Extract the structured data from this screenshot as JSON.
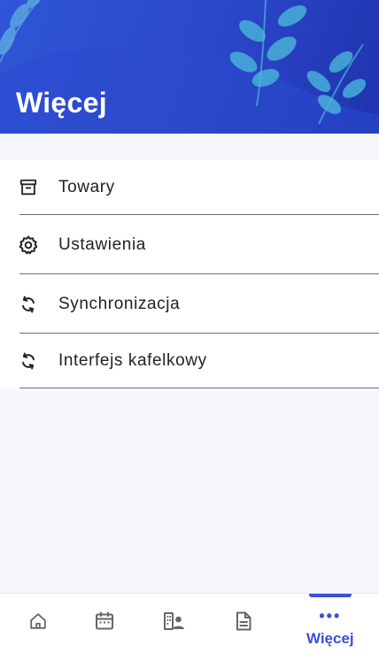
{
  "header": {
    "title": "Więcej"
  },
  "menu": {
    "items": [
      {
        "label": "Towary",
        "icon": "archive-box-icon"
      },
      {
        "label": "Ustawienia",
        "icon": "gear-icon"
      },
      {
        "label": "Synchronizacja",
        "icon": "sync-icon"
      },
      {
        "label": "Interfejs kafelkowy",
        "icon": "sync-icon"
      }
    ]
  },
  "bottom_nav": {
    "items": [
      {
        "icon": "home-icon",
        "label": ""
      },
      {
        "icon": "calendar-icon",
        "label": ""
      },
      {
        "icon": "customers-icon",
        "label": ""
      },
      {
        "icon": "document-icon",
        "label": ""
      },
      {
        "icon": "more-dots-icon",
        "label": "Więcej",
        "active": true
      }
    ]
  },
  "colors": {
    "header_start": "#2f56d8",
    "header_end": "#1f33ae",
    "accent": "#3d4fd6",
    "background": "#f6f7fc"
  }
}
